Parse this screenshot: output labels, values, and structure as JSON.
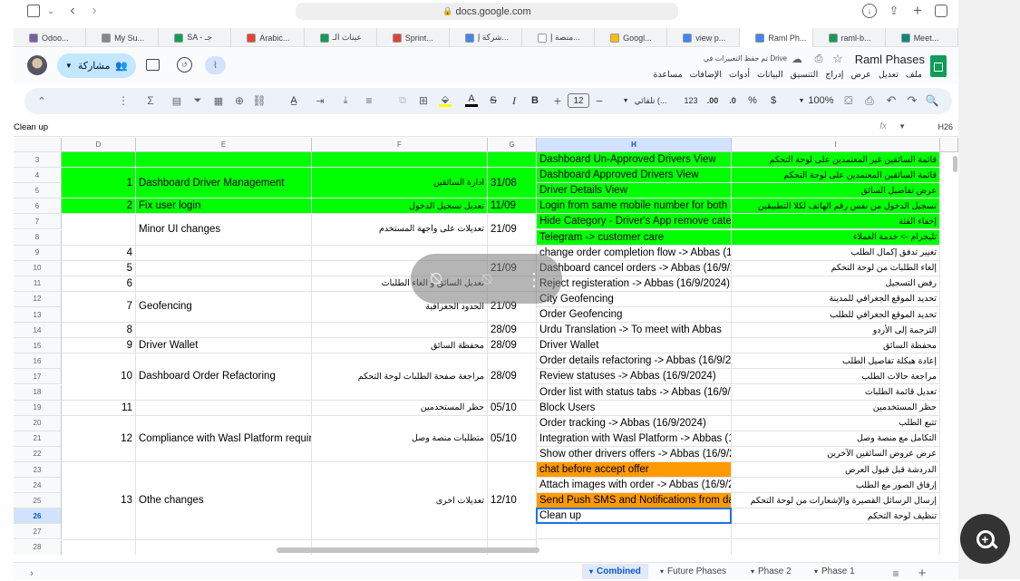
{
  "browser": {
    "url": "docs.google.com",
    "tabs": [
      {
        "label": "Odoo...",
        "color": "#7b5ea7"
      },
      {
        "label": "My Su...",
        "color": "#888888"
      },
      {
        "label": "SA - جـ",
        "color": "#0f9d58"
      },
      {
        "label": "Arabic...",
        "color": "#ea4335"
      },
      {
        "label": "عينات الـ",
        "color": "#0f9d58"
      },
      {
        "label": "Sprint...",
        "color": "#db4437"
      },
      {
        "label": "شركة إ...",
        "color": "#4285f4"
      },
      {
        "label": "منصة إ...",
        "color": "#ffffff"
      },
      {
        "label": "Googl...",
        "color": "#fbbc04"
      },
      {
        "label": "view p...",
        "color": "#4285f4"
      },
      {
        "label": "Raml Ph...",
        "color": "#4285f4"
      },
      {
        "label": "raml-b...",
        "color": "#0f9d58"
      },
      {
        "label": "Meet...",
        "color": "#00897b"
      }
    ],
    "active_tab": 10
  },
  "doc": {
    "title": "Raml Phases",
    "saved_status": "تم حفظ التغييرات في Drive",
    "share_label": "مشاركة",
    "menu": [
      "ملف",
      "تعديل",
      "عرض",
      "إدراج",
      "التنسيق",
      "البيانات",
      "أدوات",
      "الإضافات",
      "مساعدة"
    ]
  },
  "toolbar": {
    "zoom": "100%",
    "currency": "$",
    "percent": "%",
    "dec_decrease": ".0",
    "dec_increase": ".00",
    "number_format": "123",
    "font": "تلقائي (...",
    "font_size": "12",
    "bold": "B",
    "italic": "I",
    "strike": "S",
    "text_color": "A",
    "sum": "Σ"
  },
  "formula_bar": {
    "name_box": "H26",
    "fx": "fx",
    "value": "Clean up"
  },
  "grid": {
    "columns": [
      "I",
      "H",
      "G",
      "F",
      "E",
      "D"
    ],
    "selected_column": "H",
    "selected_row": "26",
    "rows": [
      {
        "num": "3",
        "I": "قائمة السائقين غير المعتمدين على لوحة التحكم",
        "H": "Dashboard Un-Approved Drivers View",
        "green": true
      },
      {
        "num": "4",
        "I": "قائمة السائقين المعتمدين على لوحة التحكم",
        "H": "Dashboard Approved Drivers View",
        "green": true
      },
      {
        "num": "5",
        "I": "عرض تفاصيل السائق",
        "H": "Driver Details View",
        "green": true
      },
      {
        "num": "6",
        "I": "تسجيل الدخول من نفس رقم الهاتف لكلا التطبيقين",
        "H": "Login from same mobile number for both a",
        "green": true
      },
      {
        "num": "7",
        "I": "إخفاء الفئة",
        "H": "Hide Category - Driver's App remove categ",
        "green": true
      },
      {
        "num": "8",
        "I": "تليجرام -> خدمة العملاء",
        "H": "Telegram -> customer care",
        "green": true
      },
      {
        "num": "9",
        "I": "تغيير تدفق إكمال الطلب",
        "H": "change order completion flow -> Abbas (16"
      },
      {
        "num": "10",
        "I": "إلغاء الطلبات من لوحة التحكم",
        "H": "Dashboard cancel orders -> Abbas (16/9/2"
      },
      {
        "num": "11",
        "I": "رفض التسجيل",
        "H": "Reject registeration -> Abbas (16/9/2024)"
      },
      {
        "num": "12",
        "I": "تحديد الموقع الجغرافي للمدينة",
        "H": "City Geofencing"
      },
      {
        "num": "13",
        "I": "تحديد الموقع الجغرافي للطلب",
        "H": "Order Geofencing"
      },
      {
        "num": "14",
        "I": "الترجمة إلى الأردو",
        "H": "Urdu Translation -> To meet with Abbas"
      },
      {
        "num": "15",
        "I": "محفظة السائق",
        "H": "Driver Wallet"
      },
      {
        "num": "16",
        "I": "إعادة هيكلة تفاصيل الطلب",
        "H": "Order details refactoring -> Abbas (16/9/20"
      },
      {
        "num": "17",
        "I": "مراجعة حالات الطلب",
        "H": "Review statuses -> Abbas (16/9/2024)"
      },
      {
        "num": "18",
        "I": "تعديل قائمة الطلبات",
        "H": "Order list with status tabs -> Abbas (16/9/2"
      },
      {
        "num": "19",
        "I": "حظر المستخدمين",
        "H": "Block Users"
      },
      {
        "num": "20",
        "I": "تتبع الطلب",
        "H": "Order tracking -> Abbas (16/9/2024)"
      },
      {
        "num": "21",
        "I": "التكامل مع منصة وصل",
        "H": "Integration with Wasl Platform -> Abbas (1"
      },
      {
        "num": "22",
        "I": "عرض عروض السائقين الآخرين",
        "H": "Show other drivers offers -> Abbas (16/9/2"
      },
      {
        "num": "23",
        "I": "الدردشة قبل قبول العرض",
        "H": "chat before accept offer",
        "orange": true
      },
      {
        "num": "24",
        "I": "إرفاق الصور مع الطلب",
        "H": "Attach images with order -> Abbas (16/9/2"
      },
      {
        "num": "25",
        "I": "إرسال الرسائل القصيرة والإشعارات من لوحة التحكم",
        "H": "Send Push  SMS and Notifications from da",
        "orange": true
      },
      {
        "num": "26",
        "I": "تنظيف لوحة التحكم",
        "H": "Clean up"
      },
      {
        "num": "27",
        "I": "",
        "H": ""
      },
      {
        "num": "28",
        "I": "",
        "H": ""
      }
    ],
    "merged": [
      {
        "d": "1",
        "e": "Dashboard Driver Management",
        "f": "ادارة السائقين",
        "g": "31/08"
      },
      {
        "d": "2",
        "e": "Fix user login",
        "f": "تعديل تسجيل الدخول",
        "g": "11/09"
      },
      {
        "d": "",
        "e": "Minor UI changes",
        "f": "تعديلات على واجهة المستخدم",
        "g": "21/09"
      },
      {
        "d": "4",
        "e": "",
        "f": "",
        "g": ""
      },
      {
        "d": "5",
        "e": "",
        "f": "",
        "g": "21/09"
      },
      {
        "d": "6",
        "e": "",
        "f": "تعديل السائق و الغاء الطلبات",
        "g": ""
      },
      {
        "d": "7",
        "e": "Geofencing",
        "f": "الحدود الجغرافية",
        "g": "21/09"
      },
      {
        "d": "8",
        "e": "",
        "f": "",
        "g": "28/09"
      },
      {
        "d": "9",
        "e": "Driver Wallet",
        "f": "محفظة السائق",
        "g": "28/09"
      },
      {
        "d": "10",
        "e": "Dashboard Order Refactoring",
        "f": "مراجعة صفحة الطلبات لوحة التحكم",
        "g": "28/09"
      },
      {
        "d": "11",
        "e": "",
        "f": "حظر المستخدمين",
        "g": "05/10"
      },
      {
        "d": "12",
        "e": "Compliance with Wasl Platform require",
        "f": "متطلبات منصة وصل",
        "g": "05/10"
      },
      {
        "d": "13",
        "e": "Othe changes",
        "f": "تعديلات اخرى",
        "g": "12/10"
      }
    ]
  },
  "sheets": {
    "tabs": [
      "Combined",
      "Future Phases",
      "Phase 2",
      "Phase 1"
    ],
    "active": "Combined"
  },
  "colors": {
    "green": "#00ff00",
    "orange": "#ff9900",
    "selection": "#1a73e8"
  }
}
